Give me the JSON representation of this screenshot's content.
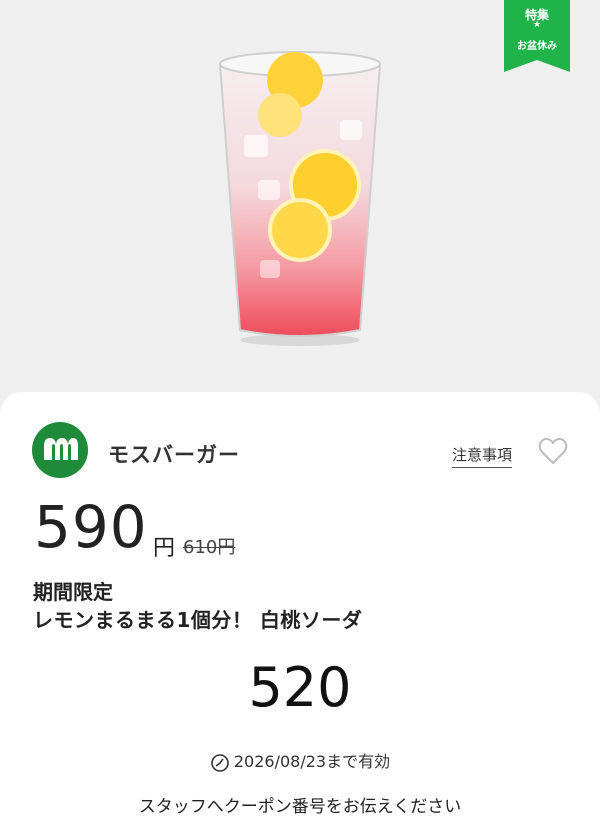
{
  "badge": {
    "top": "特集",
    "star": "★",
    "bottom": "お盆休み",
    "color": "#1fb34a"
  },
  "shop": {
    "name": "モスバーガー",
    "logo_icon": "mos-logo-icon",
    "brand_color": "#1e8a3a"
  },
  "actions": {
    "notice_label": "注意事項",
    "favorite_icon": "heart-icon"
  },
  "price": {
    "current": "590",
    "unit": "円",
    "original": "610円"
  },
  "product": {
    "line1": "期間限定",
    "line2": "レモンまるまる1個分！ 白桃ソーダ"
  },
  "coupon": {
    "code": "520"
  },
  "validity": {
    "clock_icon": "clock-icon",
    "text": "2026/08/23まで有効"
  },
  "instruction": "スタッフへクーポン番号をお伝えください"
}
